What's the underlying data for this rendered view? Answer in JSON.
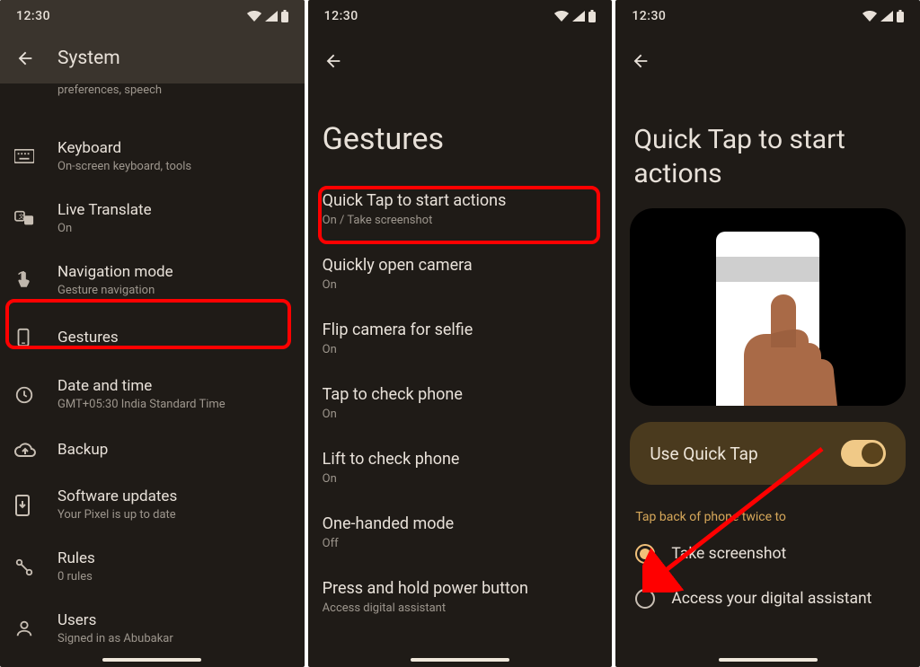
{
  "status": {
    "time": "12:30"
  },
  "screen1": {
    "header": "System",
    "cutoff_sub": "preferences, speech",
    "items": [
      {
        "title": "Keyboard",
        "sub": "On-screen keyboard, tools"
      },
      {
        "title": "Live Translate",
        "sub": "On"
      },
      {
        "title": "Navigation mode",
        "sub": "Gesture navigation"
      },
      {
        "title": "Gestures",
        "sub": ""
      },
      {
        "title": "Date and time",
        "sub": "GMT+05:30 India Standard Time"
      },
      {
        "title": "Backup",
        "sub": ""
      },
      {
        "title": "Software updates",
        "sub": "Your Pixel is up to date"
      },
      {
        "title": "Rules",
        "sub": "0 rules"
      },
      {
        "title": "Users",
        "sub": "Signed in as Abubakar"
      }
    ]
  },
  "screen2": {
    "header": "Gestures",
    "items": [
      {
        "title": "Quick Tap to start actions",
        "sub": "On / Take screenshot"
      },
      {
        "title": "Quickly open camera",
        "sub": "On"
      },
      {
        "title": "Flip camera for selfie",
        "sub": "On"
      },
      {
        "title": "Tap to check phone",
        "sub": "On"
      },
      {
        "title": "Lift to check phone",
        "sub": "On"
      },
      {
        "title": "One-handed mode",
        "sub": "Off"
      },
      {
        "title": "Press and hold power button",
        "sub": "Access digital assistant"
      }
    ]
  },
  "screen3": {
    "header": "Quick Tap to start actions",
    "toggle_label": "Use Quick Tap",
    "toggle_on": true,
    "section_label": "Tap back of phone twice to",
    "options": [
      {
        "label": "Take screenshot",
        "selected": true
      },
      {
        "label": "Access your digital assistant",
        "selected": false
      }
    ]
  }
}
